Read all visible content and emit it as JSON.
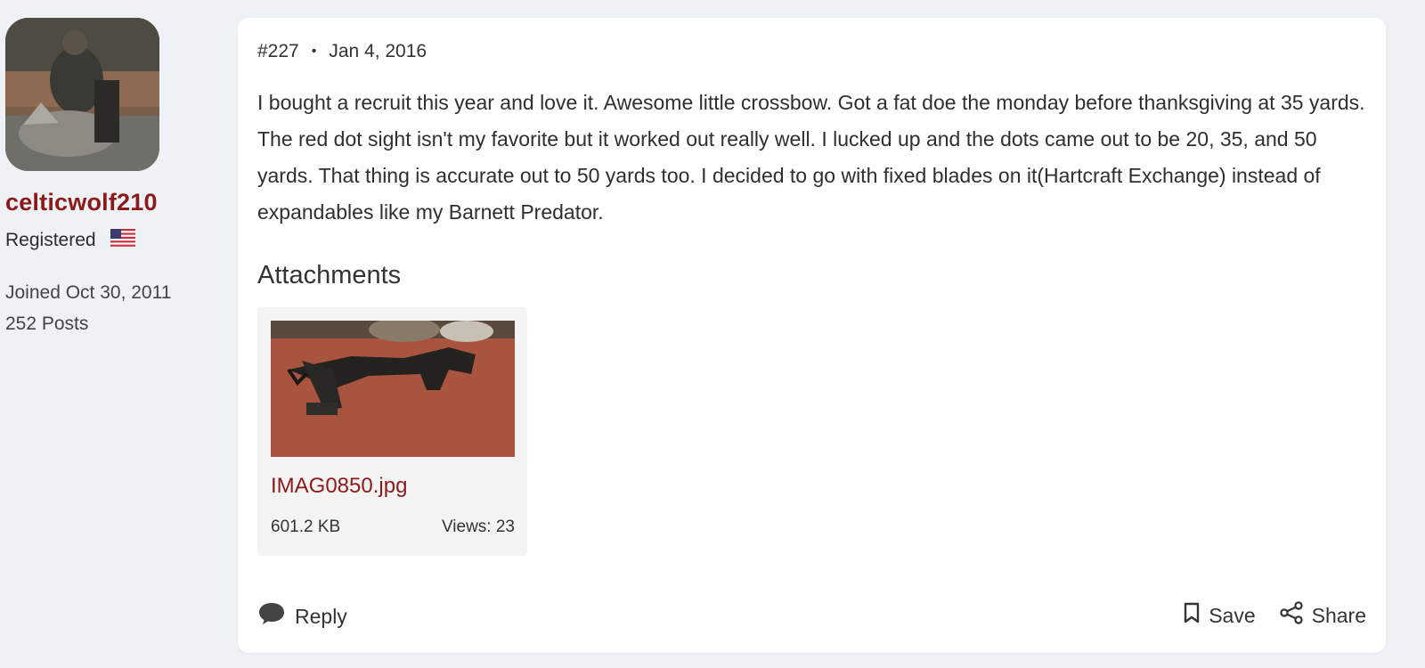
{
  "user": {
    "username": "celticwolf210",
    "role": "Registered",
    "flag_icon": "us-flag-icon",
    "joined": "Joined Oct 30, 2011",
    "posts": "252 Posts"
  },
  "post": {
    "number": "#227",
    "separator": "•",
    "date": "Jan 4, 2016",
    "body": "I bought a recruit this year and love it. Awesome little crossbow. Got a fat doe the monday before thanksgiving at 35 yards. The red dot sight isn't my favorite but it worked out really well. I lucked up and the dots came out to be 20, 35, and 50 yards. That thing is accurate out to 50 yards too. I decided to go with fixed blades on it(Hartcraft Exchange) instead of expandables like my Barnett Predator."
  },
  "attachments": {
    "heading": "Attachments",
    "items": [
      {
        "name": "IMAG0850.jpg",
        "size": "601.2 KB",
        "views": "Views: 23"
      }
    ]
  },
  "footer": {
    "reply_label": "Reply",
    "save_label": "Save",
    "share_label": "Share"
  },
  "colors": {
    "username": "#8b1a1a",
    "link": "#8b1a1a",
    "page_bg": "#eef1f5",
    "card_bg": "#ffffff"
  }
}
